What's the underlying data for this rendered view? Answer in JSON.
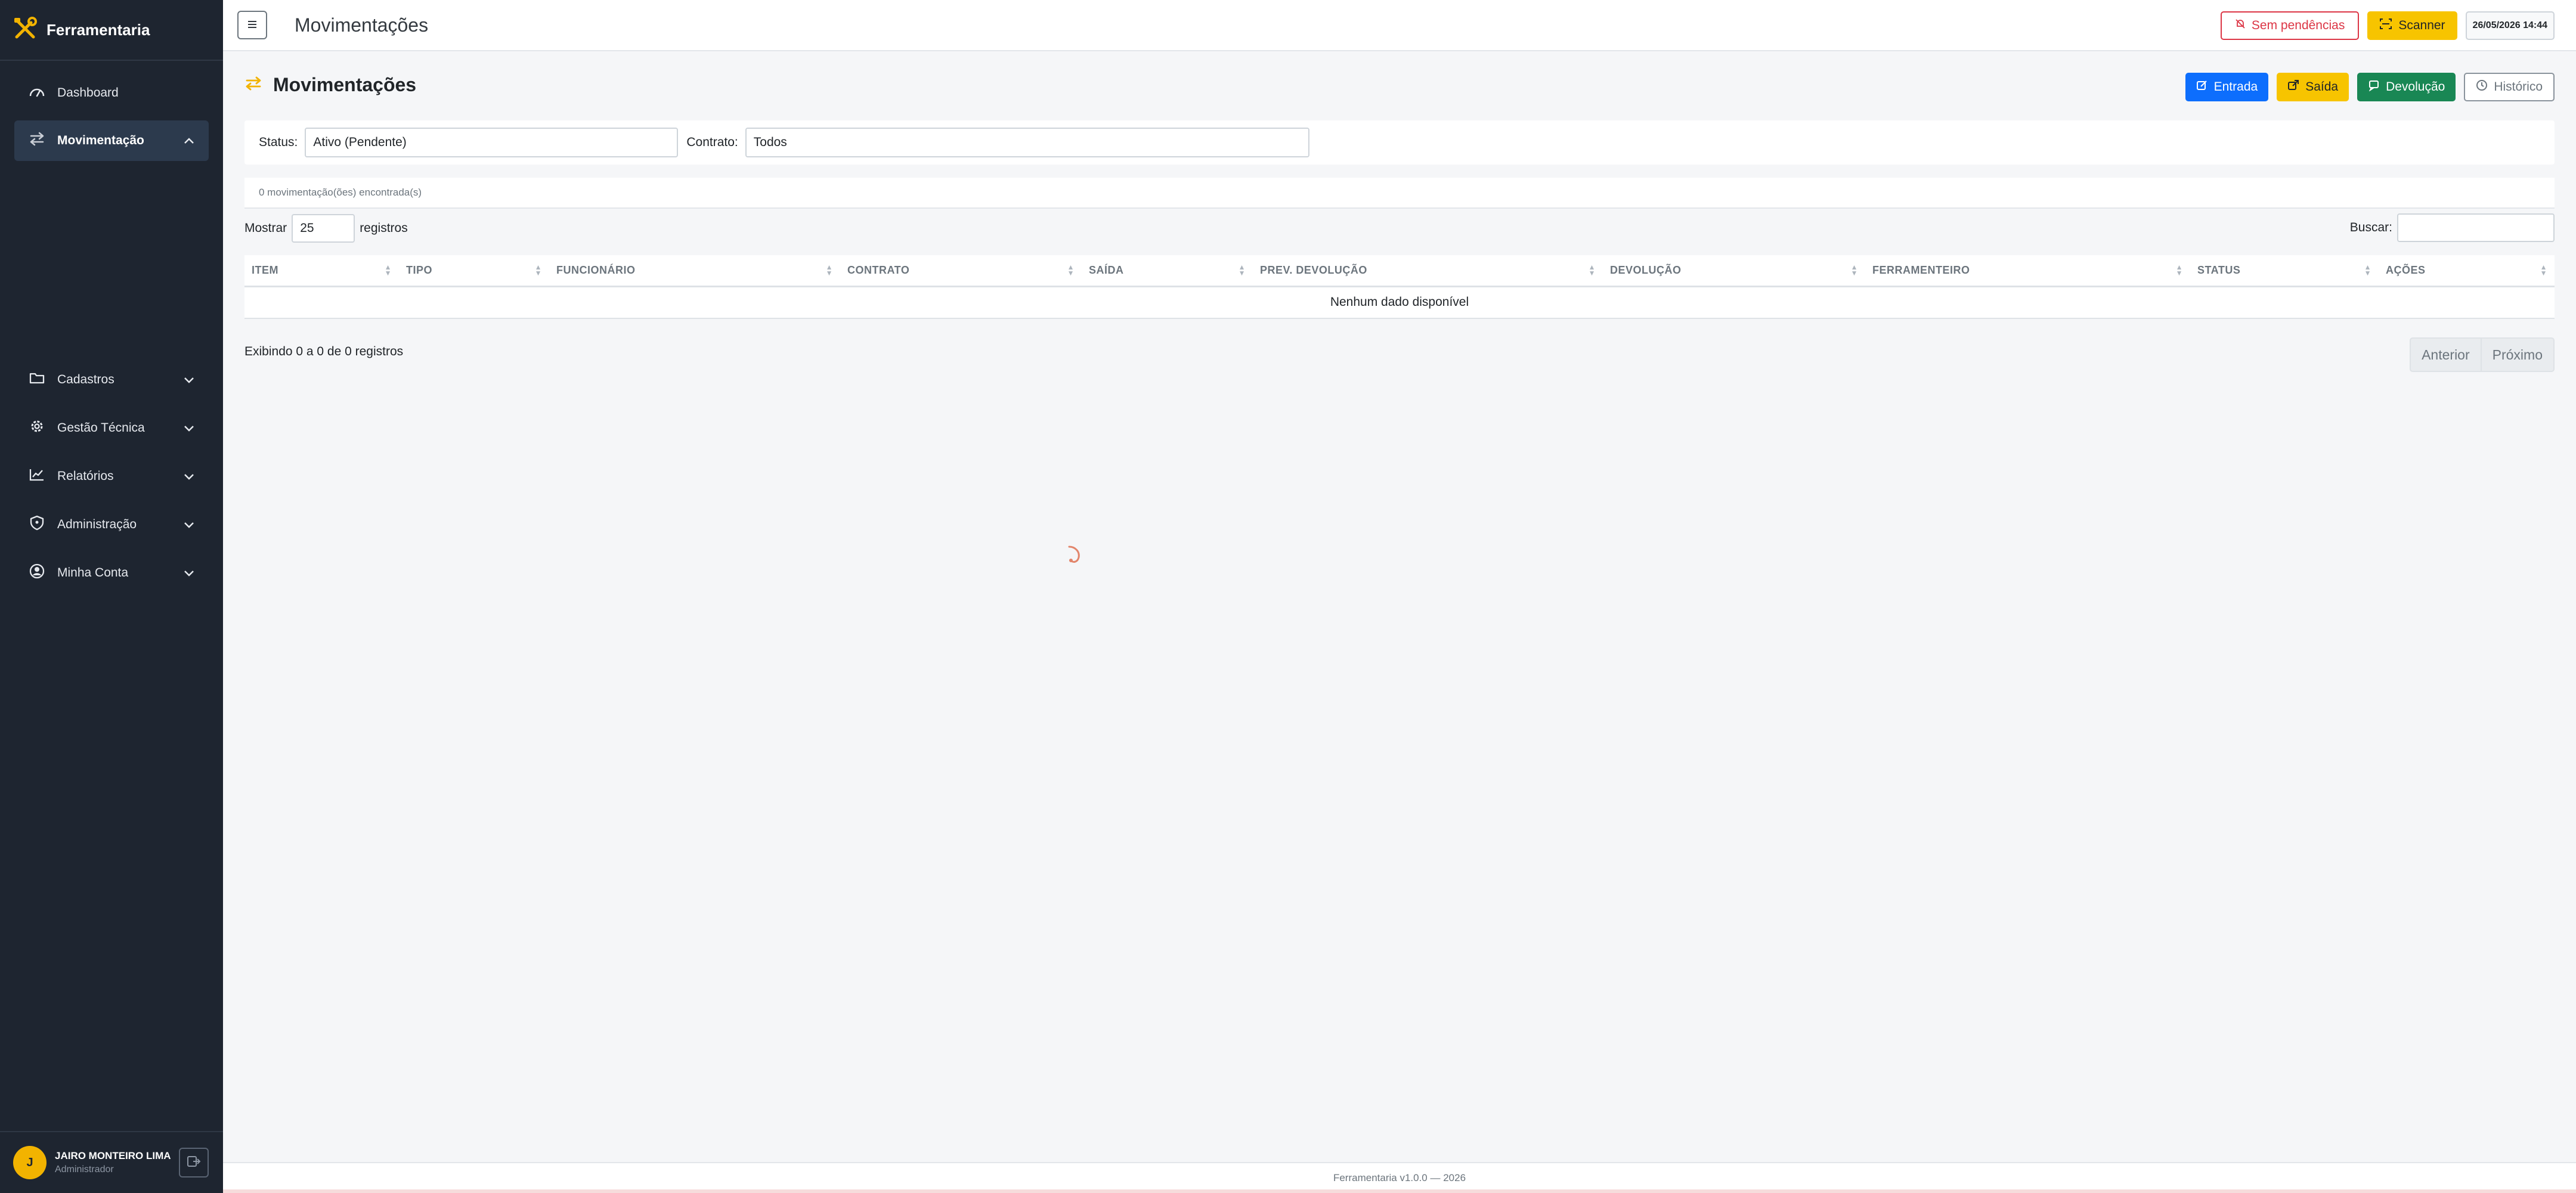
{
  "brand": {
    "name": "Ferramentaria"
  },
  "sidebar": {
    "items": [
      {
        "label": "Dashboard",
        "icon": "dashboard-icon"
      },
      {
        "label": "Movimentação",
        "icon": "swap-icon",
        "active": true
      }
    ],
    "groups": [
      {
        "label": "Cadastros",
        "icon": "folder-icon"
      },
      {
        "label": "Gestão Técnica",
        "icon": "gear-icon"
      },
      {
        "label": "Relatórios",
        "icon": "chart-line-icon"
      },
      {
        "label": "Administração",
        "icon": "shield-icon"
      },
      {
        "label": "Minha Conta",
        "icon": "user-circle-icon"
      }
    ],
    "user": {
      "initial": "J",
      "name": "JAIRO MONTEIRO LIMA",
      "role": "Administrador"
    }
  },
  "topbar": {
    "title": "Movimentações",
    "pending_label": "Sem pendências",
    "scanner_label": "Scanner",
    "datetime": "26/05/2026 14:44"
  },
  "page": {
    "title": "Movimentações",
    "actions": {
      "entrada": "Entrada",
      "saida": "Saída",
      "devolucao": "Devolução",
      "historico": "Histórico"
    }
  },
  "filters": {
    "status_label": "Status:",
    "status_value": "Ativo (Pendente)",
    "contract_label": "Contrato:",
    "contract_value": "Todos"
  },
  "results": {
    "count_text": "0 movimentação(ões) encontrada(s)"
  },
  "table": {
    "show_label": "Mostrar",
    "page_length": "25",
    "records_label": "registros",
    "search_label": "Buscar:",
    "columns": [
      "ITEM",
      "TIPO",
      "FUNCIONÁRIO",
      "CONTRATO",
      "SAÍDA",
      "PREV. DEVOLUÇÃO",
      "DEVOLUÇÃO",
      "FERRAMENTEIRO",
      "STATUS",
      "AÇÕES"
    ],
    "empty_text": "Nenhum dado disponível",
    "info": "Exibindo 0 a 0 de 0 registros",
    "prev_label": "Anterior",
    "next_label": "Próximo"
  },
  "footer": {
    "text": "Ferramentaria v1.0.0 — 2026"
  },
  "colors": {
    "sidebar_bg": "#1e2530",
    "accent_yellow": "#f7c400",
    "primary": "#0d6efd",
    "success": "#198754",
    "danger": "#dc3545"
  }
}
